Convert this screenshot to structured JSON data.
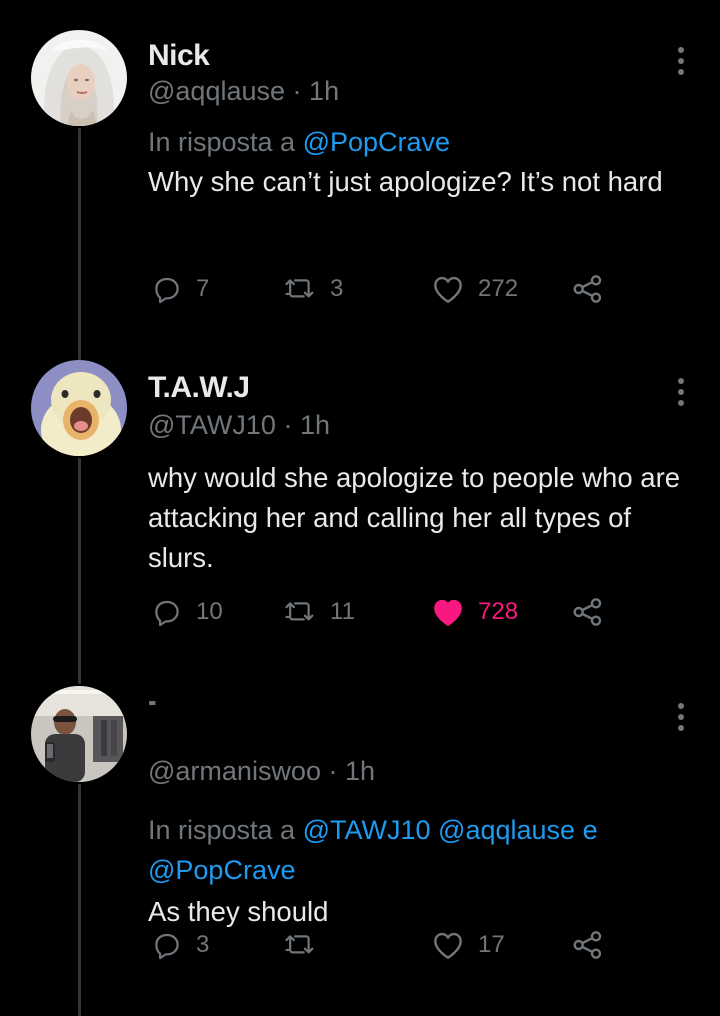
{
  "tweets": [
    {
      "name": "Nick",
      "handle": "@aqqlause",
      "time": "1h",
      "replying_prefix": "In risposta a",
      "replying_mentions": [
        "@PopCrave"
      ],
      "text": "Why she can’t just apologize? It’s not hard",
      "replies": "7",
      "retweets": "3",
      "likes": "272",
      "liked": false,
      "avatar": "platinum-hair-avatar"
    },
    {
      "name": "T.A.W.J",
      "handle": "@TAWJ10",
      "time": "1h",
      "text": "why would she apologize to people who are attacking her and calling her all types of slurs.",
      "replies": "10",
      "retweets": "11",
      "likes": "728",
      "liked": true,
      "avatar": "duck-avatar"
    },
    {
      "name": "⁼",
      "handle": "@armaniswoo",
      "time": "1h",
      "replying_prefix": "In risposta a",
      "replying_mentions": [
        "@TAWJ10",
        "@aqqlause",
        "@PopCrave"
      ],
      "replying_joiner": "e",
      "text": "As they should",
      "replies": "3",
      "retweets": "",
      "likes": "17",
      "liked": false,
      "avatar": "mirror-selfie-avatar"
    }
  ],
  "separator": "·",
  "colors": {
    "background": "#000000",
    "text": "#e7e9ea",
    "secondary": "#71767b",
    "accent": "#1d9bf0",
    "like": "#f91880",
    "thread_line": "#333639"
  },
  "icons": [
    "reply-icon",
    "retweet-icon",
    "like-icon",
    "share-icon",
    "more-icon"
  ]
}
